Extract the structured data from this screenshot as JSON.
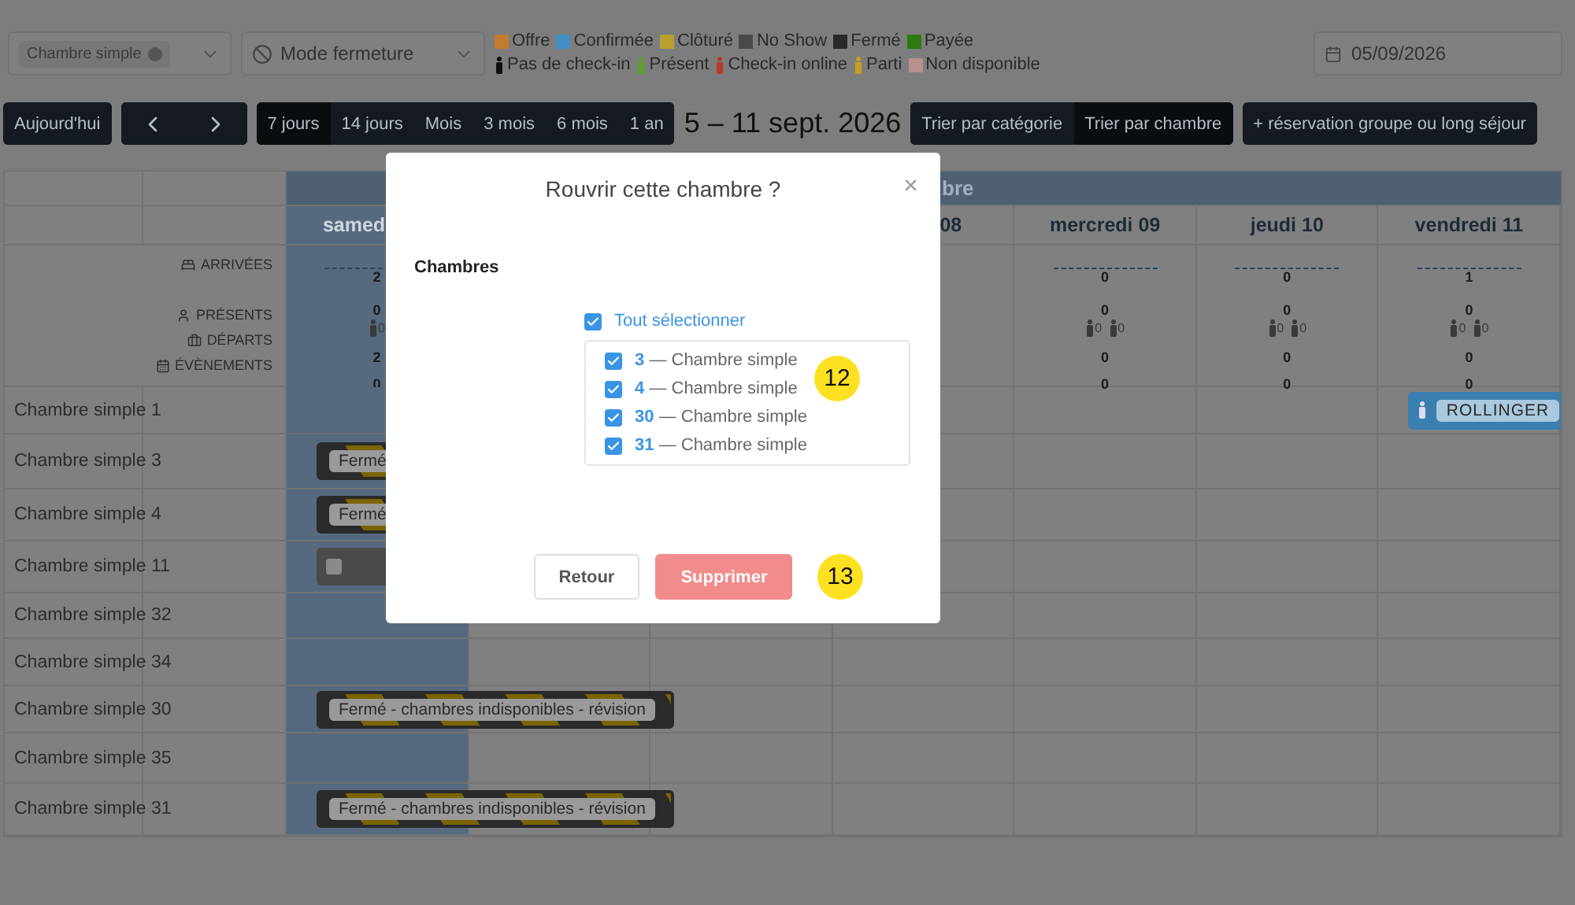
{
  "filters": {
    "room_tag": "Chambre simple",
    "mode": "Mode fermeture",
    "date": "05/09/2026"
  },
  "legend": [
    {
      "kind": "swatch",
      "label": "Offre",
      "color": "#c07b2e"
    },
    {
      "kind": "swatch",
      "label": "Confirmée",
      "color": "#3f8fc2"
    },
    {
      "kind": "swatch",
      "label": "Clôturé",
      "color": "#b8a030"
    },
    {
      "kind": "swatch",
      "label": "No Show",
      "color": "#4a4a4a"
    },
    {
      "kind": "swatch",
      "label": "Fermé",
      "color": "#2a2a2a"
    },
    {
      "kind": "swatch",
      "label": "Payée",
      "color": "#2d7a10"
    },
    {
      "kind": "person",
      "label": "Pas de check-in",
      "color": "#111111"
    },
    {
      "kind": "person",
      "label": "Présent",
      "color": "#5aa02a"
    },
    {
      "kind": "person",
      "label": "Check-in online",
      "color": "#b83a2a"
    },
    {
      "kind": "person",
      "label": "Parti",
      "color": "#c8a020"
    },
    {
      "kind": "swatch",
      "label": "Non disponible",
      "color": "#b89090"
    }
  ],
  "toolbar": {
    "today": "Aujourd'hui",
    "periods": [
      {
        "label": "7 jours",
        "selected": true
      },
      {
        "label": "14 jours",
        "selected": false
      },
      {
        "label": "Mois",
        "selected": false
      },
      {
        "label": "3 mois",
        "selected": false
      },
      {
        "label": "6 mois",
        "selected": false
      },
      {
        "label": "1 an",
        "selected": false
      }
    ],
    "range": "5 – 11 sept. 2026",
    "sorts": [
      {
        "label": "Trier par catégorie",
        "selected": false
      },
      {
        "label": "Trier par chambre",
        "selected": true
      }
    ],
    "group_button": "+ réservation groupe ou long séjour"
  },
  "calendar": {
    "month": "bre",
    "stat_labels": [
      "ARRIVÉES",
      "PRÉSENTS",
      "DÉPARTS",
      "ÉVÈNEMENTS"
    ],
    "days": [
      {
        "label": "samed",
        "selected": true,
        "arrivals": "2",
        "present": "0",
        "sub": [
          "0"
        ],
        "departures": "2",
        "events": "0"
      },
      {
        "label": "08",
        "selected": false
      },
      {
        "label": "mercredi 09",
        "selected": false,
        "arrivals": "0",
        "present": "0",
        "sub": [
          "0",
          "0"
        ],
        "departures": "0",
        "events": "0"
      },
      {
        "label": "jeudi 10",
        "selected": false,
        "arrivals": "0",
        "present": "0",
        "sub": [
          "0",
          "0"
        ],
        "departures": "0",
        "events": "0"
      },
      {
        "label": "vendredi 11",
        "selected": false,
        "arrivals": "1",
        "present": "0",
        "sub": [
          "0",
          "0"
        ],
        "departures": "0",
        "events": "0"
      }
    ],
    "rooms": [
      {
        "category": "Chambre simple",
        "number": "1",
        "booking": {
          "kind": "booking",
          "label": "ROLLINGER"
        }
      },
      {
        "category": "Chambre simple",
        "number": "3",
        "booking": {
          "kind": "closed",
          "label": "Fermé"
        }
      },
      {
        "category": "Chambre simple",
        "number": "4",
        "booking": {
          "kind": "closed",
          "label": "Fermé"
        }
      },
      {
        "category": "Chambre simple",
        "number": "11",
        "booking": {
          "kind": "blocked"
        }
      },
      {
        "category": "Chambre simple",
        "number": "32"
      },
      {
        "category": "Chambre simple",
        "number": "34"
      },
      {
        "category": "Chambre simple",
        "number": "30",
        "booking": {
          "kind": "closed",
          "label": "Fermé - chambres indisponibles - révision"
        }
      },
      {
        "category": "Chambre simple",
        "number": "35"
      },
      {
        "category": "Chambre simple",
        "number": "31",
        "booking": {
          "kind": "closed",
          "label": "Fermé - chambres indisponibles - révision"
        }
      }
    ]
  },
  "modal": {
    "title": "Rouvrir cette chambre ?",
    "close": "×",
    "section": "Chambres",
    "select_all": {
      "label": "Tout sélectionner",
      "checked": true
    },
    "rooms": [
      {
        "number": "3",
        "name": "— Chambre simple",
        "checked": true
      },
      {
        "number": "4",
        "name": "— Chambre simple",
        "checked": true
      },
      {
        "number": "30",
        "name": "— Chambre simple",
        "checked": true
      },
      {
        "number": "31",
        "name": "— Chambre simple",
        "checked": true
      }
    ],
    "back": "Retour",
    "delete": "Supprimer"
  },
  "markers": [
    {
      "label": "12",
      "kind": "list"
    },
    {
      "label": "13",
      "kind": "button"
    }
  ]
}
